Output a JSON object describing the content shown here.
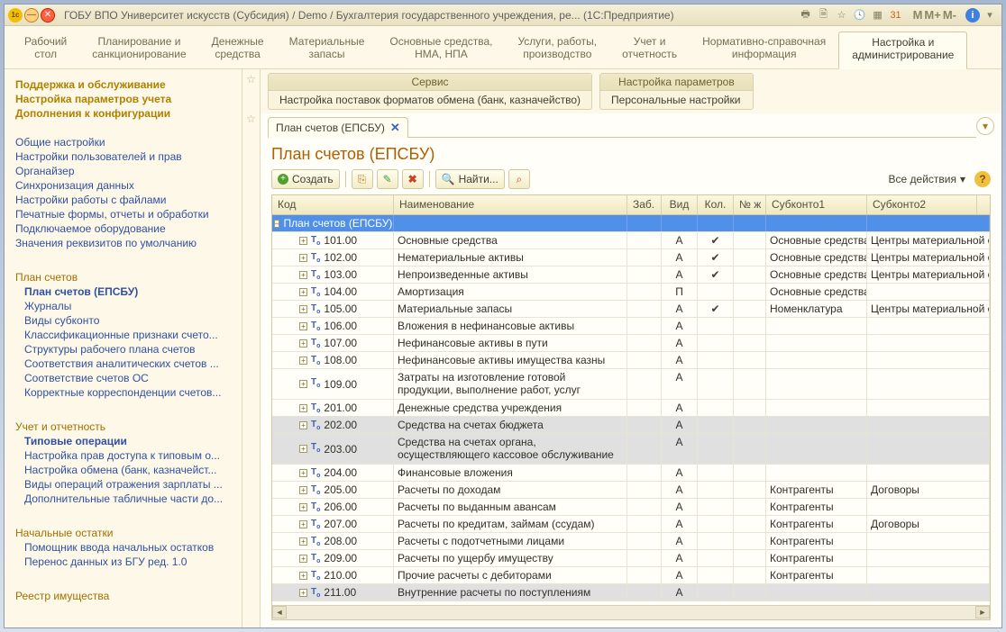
{
  "titlebar": {
    "title": "ГОБУ ВПО Университет искусств (Субсидия) / Demo / Бухгалтерия государственного учреждения, ре...   (1С:Предприятие)",
    "m1": "M",
    "m2": "M+",
    "m3": "M-"
  },
  "sections": [
    "Рабочий\nстол",
    "Планирование и\nсанкционирование",
    "Денежные\nсредства",
    "Материальные\nзапасы",
    "Основные средства,\nНМА, НПА",
    "Услуги, работы,\nпроизводство",
    "Учет и\nотчетность",
    "Нормативно-справочная\nинформация",
    "Настройка и\nадминистрирование"
  ],
  "activeSection": 8,
  "sidebar": {
    "group1": [
      "Поддержка и обслуживание",
      "Настройка параметров учета",
      "Дополнения к конфигурации"
    ],
    "links1": [
      "Общие настройки",
      "Настройки пользователей и прав",
      "Органайзер",
      "Синхронизация данных",
      "Настройки работы с файлами",
      "Печатные формы, отчеты и обработки",
      "Подключаемое оборудование",
      "Значения реквизитов по умолчанию"
    ],
    "plan_head": "План счетов",
    "plan_links": [
      "План счетов (ЕПСБУ)",
      "Журналы",
      "Виды субконто",
      "Классификационные признаки счето...",
      "Структуры рабочего плана счетов",
      "Соответствия аналитических счетов ...",
      "Соответствие счетов ОС",
      "Корректные корреспонденции счетов..."
    ],
    "uchet_head": "Учет и отчетность",
    "uchet_links": [
      "Типовые операции",
      "Настройка прав доступа к типовым о...",
      "Настройка обмена (банк, казначейст...",
      "Виды операций отражения зарплаты ...",
      "Дополнительные табличные части до..."
    ],
    "nach_head": "Начальные остатки",
    "nach_links": [
      "Помощник ввода начальных остатков",
      "Перенос данных из БГУ ред. 1.0"
    ],
    "reestr_head": "Реестр имущества"
  },
  "service": {
    "s1_head": "Сервис",
    "s1_body": "Настройка поставок форматов обмена (банк, казначейство)",
    "s2_head": "Настройка параметров",
    "s2_body": "Персональные настройки"
  },
  "doc_tab": "План счетов (ЕПСБУ)",
  "page_title": "План счетов (ЕПСБУ)",
  "toolbar": {
    "create": "Создать",
    "find": "Найти...",
    "all_actions": "Все действия"
  },
  "columns": {
    "code": "Код",
    "name": "Наименование",
    "zab": "Заб.",
    "vid": "Вид",
    "kol": "Кол.",
    "nz": "№ ж",
    "s1": "Субконто1",
    "s2": "Субконто2"
  },
  "root_row": "План счетов (ЕПСБУ)",
  "rows": [
    {
      "code": "101.00",
      "name": "Основные средства",
      "vid": "А",
      "kol": "✔",
      "s1": "Основные средства",
      "s2": "Центры материальной отве"
    },
    {
      "code": "102.00",
      "name": "Нематериальные активы",
      "vid": "А",
      "kol": "✔",
      "s1": "Основные средства",
      "s2": "Центры материальной отве"
    },
    {
      "code": "103.00",
      "name": "Непроизведенные активы",
      "vid": "А",
      "kol": "✔",
      "s1": "Основные средства",
      "s2": "Центры материальной отве"
    },
    {
      "code": "104.00",
      "name": "Амортизация",
      "vid": "П",
      "kol": "",
      "s1": "Основные средства",
      "s2": ""
    },
    {
      "code": "105.00",
      "name": "Материальные запасы",
      "vid": "А",
      "kol": "✔",
      "s1": "Номенклатура",
      "s2": "Центры материальной отве"
    },
    {
      "code": "106.00",
      "name": "Вложения в нефинансовые активы",
      "vid": "А",
      "kol": "",
      "s1": "",
      "s2": ""
    },
    {
      "code": "107.00",
      "name": "Нефинансовые активы в пути",
      "vid": "А",
      "kol": "",
      "s1": "",
      "s2": ""
    },
    {
      "code": "108.00",
      "name": "Нефинансовые активы имущества казны",
      "vid": "А",
      "kol": "",
      "s1": "",
      "s2": ""
    },
    {
      "code": "109.00",
      "name": "Затраты на изготовление готовой продукции, выполнение работ, услуг",
      "vid": "А",
      "kol": "",
      "s1": "",
      "s2": "",
      "tall": true
    },
    {
      "code": "201.00",
      "name": "Денежные средства учреждения",
      "vid": "А",
      "kol": "",
      "s1": "",
      "s2": ""
    },
    {
      "code": "202.00",
      "name": "Средства на счетах бюджета",
      "vid": "А",
      "kol": "",
      "s1": "",
      "s2": "",
      "grey": true
    },
    {
      "code": "203.00",
      "name": "Средства на счетах органа, осуществляющего кассовое обслуживание",
      "vid": "А",
      "kol": "",
      "s1": "",
      "s2": "",
      "grey": true,
      "tall": true
    },
    {
      "code": "204.00",
      "name": "Финансовые вложения",
      "vid": "А",
      "kol": "",
      "s1": "",
      "s2": ""
    },
    {
      "code": "205.00",
      "name": "Расчеты по доходам",
      "vid": "А",
      "kol": "",
      "s1": "Контрагенты",
      "s2": "Договоры"
    },
    {
      "code": "206.00",
      "name": "Расчеты по выданным авансам",
      "vid": "А",
      "kol": "",
      "s1": "Контрагенты",
      "s2": ""
    },
    {
      "code": "207.00",
      "name": "Расчеты по кредитам, займам (ссудам)",
      "vid": "А",
      "kol": "",
      "s1": "Контрагенты",
      "s2": "Договоры"
    },
    {
      "code": "208.00",
      "name": "Расчеты с подотчетными лицами",
      "vid": "А",
      "kol": "",
      "s1": "Контрагенты",
      "s2": ""
    },
    {
      "code": "209.00",
      "name": "Расчеты по ущербу имуществу",
      "vid": "А",
      "kol": "",
      "s1": "Контрагенты",
      "s2": ""
    },
    {
      "code": "210.00",
      "name": "Прочие расчеты с дебиторами",
      "vid": "А",
      "kol": "",
      "s1": "Контрагенты",
      "s2": ""
    },
    {
      "code": "211.00",
      "name": "Внутренние расчеты по поступлениям",
      "vid": "А",
      "kol": "",
      "s1": "",
      "s2": "",
      "grey": true
    }
  ]
}
